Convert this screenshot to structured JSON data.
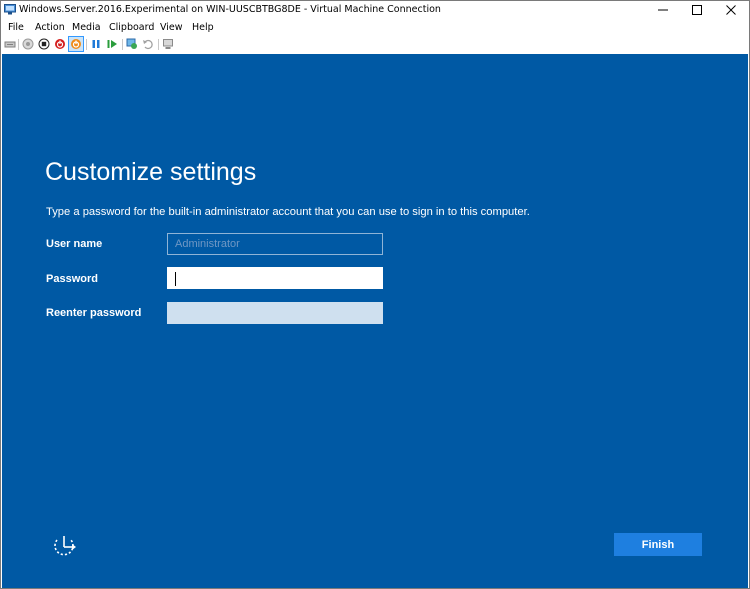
{
  "window": {
    "title": "Windows.Server.2016.Experimental on WIN-UUSCBTBG8DE - Virtual Machine Connection",
    "controls": [
      "minimize-icon",
      "maximize-icon",
      "close-icon"
    ]
  },
  "menubar": {
    "items": [
      "File",
      "Action",
      "Media",
      "Clipboard",
      "View",
      "Help"
    ]
  },
  "toolbar": {
    "icons": [
      "ctrl-alt-del-icon",
      "start-icon",
      "turn-off-icon",
      "shutdown-icon",
      "save-state-icon",
      "pause-icon",
      "resume-icon",
      "checkpoint-icon",
      "revert-icon",
      "enhanced-session-icon"
    ],
    "active_icon": "save-state-icon"
  },
  "setup": {
    "heading": "Customize settings",
    "description": "Type a password for the built-in administrator account that you can use to sign in to this computer.",
    "fields": [
      {
        "label": "User name",
        "value": "Administrator",
        "state": "disabled"
      },
      {
        "label": "Password",
        "value": "",
        "state": "focused"
      },
      {
        "label": "Reenter password",
        "value": "",
        "state": "inactive"
      }
    ],
    "finish_label": "Finish",
    "ease_of_access_icon": "ease-of-access-icon"
  },
  "colors": {
    "background": "#0059a4",
    "button": "#1e7fe0",
    "text": "#ffffff"
  }
}
